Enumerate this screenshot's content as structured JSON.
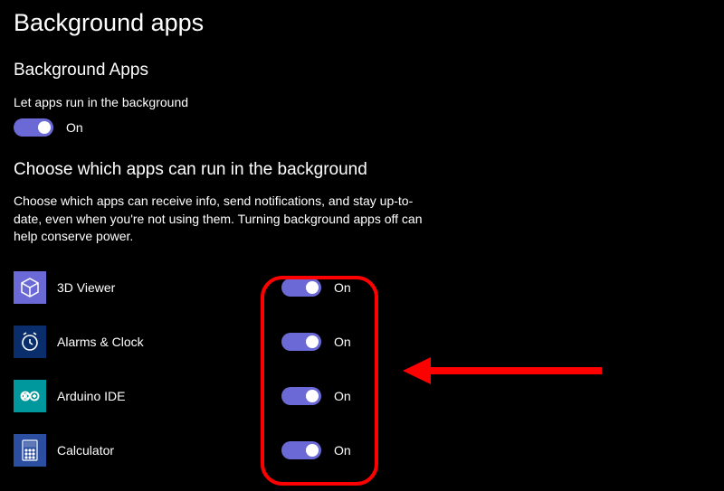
{
  "page_title": "Background apps",
  "section_heading": "Background Apps",
  "master": {
    "label": "Let apps run in the background",
    "state_label": "On"
  },
  "choose_heading": "Choose which apps can run in the background",
  "choose_description": "Choose which apps can receive info, send notifications, and stay up-to-date, even when you're not using them. Turning background apps off can help conserve power.",
  "apps": [
    {
      "name": "3D Viewer",
      "state_label": "On",
      "icon": "cube-icon",
      "icon_bg": "#6b69d6",
      "icon_fg": "#ffffff"
    },
    {
      "name": "Alarms & Clock",
      "state_label": "On",
      "icon": "clock-icon",
      "icon_bg": "#0a2e6b",
      "icon_fg": "#ffffff"
    },
    {
      "name": "Arduino IDE",
      "state_label": "On",
      "icon": "infinity-icon",
      "icon_bg": "#00979d",
      "icon_fg": "#ffffff"
    },
    {
      "name": "Calculator",
      "state_label": "On",
      "icon": "calculator-icon",
      "icon_bg": "#2b4ea0",
      "icon_fg": "#ffffff"
    }
  ],
  "colors": {
    "toggle_on": "#6b69d6",
    "annotation": "#ff0000"
  }
}
